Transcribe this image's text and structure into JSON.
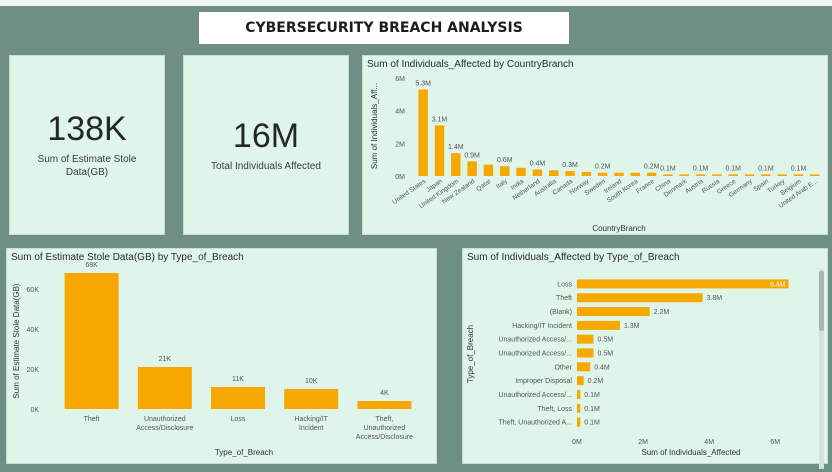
{
  "title": "CYBERSECURITY BREACH ANALYSIS",
  "colors": {
    "bar": "#f6a800",
    "panel_bg": "#dff5ea",
    "page_bg": "#6f8f85"
  },
  "cards": [
    {
      "value": "138K",
      "label": "Sum of Estimate Stole Data(GB)"
    },
    {
      "value": "16M",
      "label": "Total Individuals Affected"
    }
  ],
  "chart_data": [
    {
      "type": "bar",
      "title": "Sum of Individuals_Affected by CountryBranch",
      "xlabel": "CountryBranch",
      "ylabel": "Sum of Individuals_Aff...",
      "ylim": [
        0,
        6
      ],
      "yticks": [
        "0M",
        "2M",
        "4M",
        "6M"
      ],
      "categories": [
        "United States",
        "Japan",
        "United Kingdom",
        "New Zealand",
        "Qatar",
        "Italy",
        "India",
        "Netherland",
        "Australia",
        "Canada",
        "Norway",
        "Sweden",
        "Ireland",
        "South Korea",
        "France",
        "China",
        "Denmark",
        "Austria",
        "Russia",
        "Greece",
        "Germany",
        "Spain",
        "Turkey",
        "Belgium",
        "United Arab E..."
      ],
      "values": [
        5.3,
        3.1,
        1.4,
        0.9,
        0.7,
        0.6,
        0.5,
        0.4,
        0.35,
        0.3,
        0.25,
        0.2,
        0.2,
        0.2,
        0.2,
        0.1,
        0.1,
        0.1,
        0.1,
        0.1,
        0.1,
        0.1,
        0.1,
        0.1,
        0.1
      ],
      "data_labels": [
        "5.3M",
        "3.1M",
        "1.4M",
        "0.9M",
        "",
        "0.6M",
        "",
        "0.4M",
        "",
        "0.3M",
        "",
        "0.2M",
        "",
        "",
        "0.2M",
        "0.1M",
        "",
        "0.1M",
        "",
        "0.1M",
        "",
        "0.1M",
        "",
        "0.1M",
        ""
      ]
    },
    {
      "type": "bar",
      "title": "Sum of Estimate Stole Data(GB) by Type_of_Breach",
      "xlabel": "Type_of_Breach",
      "ylabel": "Sum of Estimate Stole Data(GB)",
      "ylim": [
        0,
        70
      ],
      "yticks": [
        "0K",
        "20K",
        "40K",
        "60K"
      ],
      "categories": [
        "Theft",
        "Unauthorized Access/Disclosure",
        "Loss",
        "Hacking/IT Incident",
        "Theft, Unauthorized Access/Disclosure"
      ],
      "category_lines": [
        [
          "Theft"
        ],
        [
          "Unauthorized",
          "Access/Disclosure"
        ],
        [
          "Loss"
        ],
        [
          "Hacking/IT",
          "Incident"
        ],
        [
          "Theft,",
          "Unauthorized",
          "Access/Disclosure"
        ]
      ],
      "values": [
        68,
        21,
        11,
        10,
        4
      ],
      "data_labels": [
        "68K",
        "21K",
        "11K",
        "10K",
        "4K"
      ]
    },
    {
      "type": "bar",
      "orientation": "horizontal",
      "title": "Sum of Individuals_Affected by Type_of_Breach",
      "xlabel": "Sum of Individuals_Affected",
      "ylabel": "Type_of_Breach",
      "xlim": [
        0,
        6.9
      ],
      "xticks": [
        "0M",
        "2M",
        "4M",
        "6M"
      ],
      "categories": [
        "Loss",
        "Theft",
        "(Blank)",
        "Hacking/IT Incident",
        "Unauthorized Access/...",
        "Unauthorized Access/...",
        "Other",
        "Improper Disposal",
        "Unauthorized Access/...",
        "Theft, Loss",
        "Theft, Unauthorized A..."
      ],
      "values": [
        6.4,
        3.8,
        2.2,
        1.3,
        0.5,
        0.5,
        0.4,
        0.2,
        0.1,
        0.1,
        0.1
      ],
      "data_labels": [
        "6.4M",
        "3.8M",
        "2.2M",
        "1.3M",
        "0.5M",
        "0.5M",
        "0.4M",
        "0.2M",
        "0.1M",
        "0.1M",
        "0.1M"
      ]
    }
  ]
}
